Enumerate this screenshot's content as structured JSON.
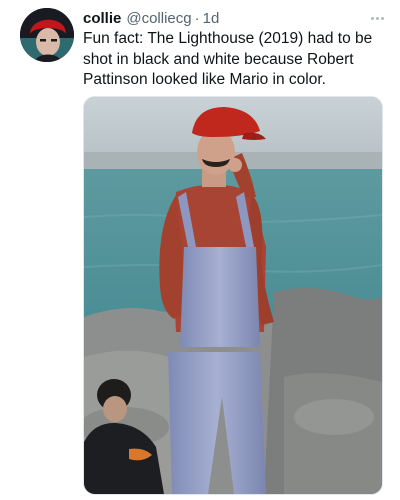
{
  "tweet": {
    "author_name": "collie",
    "handle": "@colliecg",
    "separator": "·",
    "time": "1d",
    "text": "Fun fact: The Lighthouse (2019) had to be shot in black and white because Robert Pattinson looked like Mario in color.",
    "more_icon": "more-dots-icon"
  },
  "colors": {
    "text_primary": "#0f1419",
    "text_secondary": "#536471",
    "background": "#ffffff"
  }
}
